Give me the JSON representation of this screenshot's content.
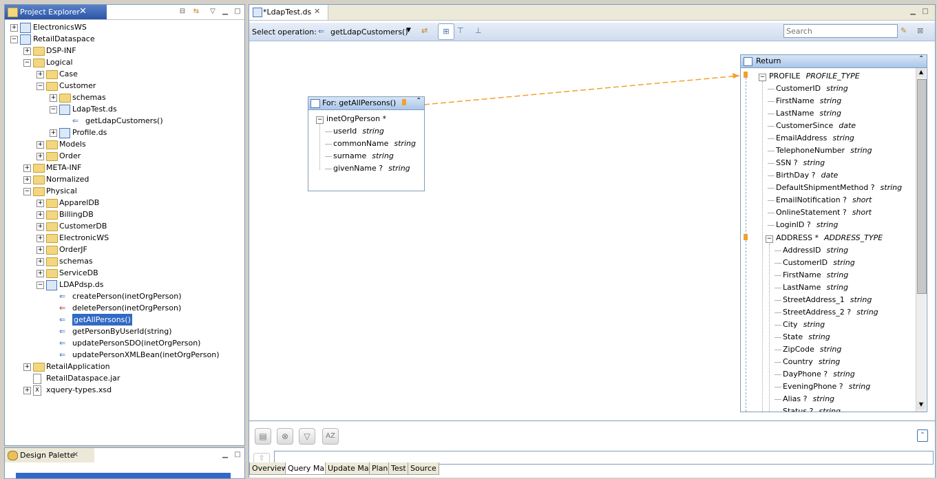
{
  "project_explorer": {
    "title": "Project Explorer",
    "tree": [
      {
        "label": "ElectronicsWS",
        "level": 0,
        "icon": "project-icon",
        "expander": "+"
      },
      {
        "label": "RetailDataspace",
        "level": 0,
        "icon": "project-icon",
        "expander": "-"
      },
      {
        "label": "DSP-INF",
        "level": 1,
        "icon": "folder-icon",
        "expander": "+"
      },
      {
        "label": "Logical",
        "level": 1,
        "icon": "folder-icon",
        "expander": "-"
      },
      {
        "label": "Case",
        "level": 2,
        "icon": "folder-icon",
        "expander": "+"
      },
      {
        "label": "Customer",
        "level": 2,
        "icon": "folder-icon",
        "expander": "-"
      },
      {
        "label": "schemas",
        "level": 3,
        "icon": "folder-icon",
        "expander": "+"
      },
      {
        "label": "LdapTest.ds",
        "level": 3,
        "icon": "dataservice-icon",
        "expander": "-"
      },
      {
        "label": "getLdapCustomers()",
        "level": 4,
        "icon": "operation-icon",
        "expander": ""
      },
      {
        "label": "Profile.ds",
        "level": 3,
        "icon": "dataservice-icon",
        "expander": "+"
      },
      {
        "label": "Models",
        "level": 2,
        "icon": "folder-icon",
        "expander": "+"
      },
      {
        "label": "Order",
        "level": 2,
        "icon": "folder-icon",
        "expander": "+"
      },
      {
        "label": "META-INF",
        "level": 1,
        "icon": "folder-icon",
        "expander": "+"
      },
      {
        "label": "Normalized",
        "level": 1,
        "icon": "folder-icon",
        "expander": "+"
      },
      {
        "label": "Physical",
        "level": 1,
        "icon": "folder-icon",
        "expander": "-"
      },
      {
        "label": "ApparelDB",
        "level": 2,
        "icon": "folder-icon",
        "expander": "+"
      },
      {
        "label": "BillingDB",
        "level": 2,
        "icon": "folder-icon",
        "expander": "+"
      },
      {
        "label": "CustomerDB",
        "level": 2,
        "icon": "folder-icon",
        "expander": "+"
      },
      {
        "label": "ElectronicWS",
        "level": 2,
        "icon": "folder-icon",
        "expander": "+"
      },
      {
        "label": "OrderJF",
        "level": 2,
        "icon": "folder-icon",
        "expander": "+"
      },
      {
        "label": "schemas",
        "level": 2,
        "icon": "folder-icon",
        "expander": "+"
      },
      {
        "label": "ServiceDB",
        "level": 2,
        "icon": "folder-icon",
        "expander": "+"
      },
      {
        "label": "LDAPdsp.ds",
        "level": 2,
        "icon": "dataservice-icon",
        "expander": "-"
      },
      {
        "label": "createPerson(inetOrgPerson)",
        "level": 3,
        "icon": "create-operation-icon",
        "expander": ""
      },
      {
        "label": "deletePerson(inetOrgPerson)",
        "level": 3,
        "icon": "delete-operation-icon",
        "expander": ""
      },
      {
        "label": "getAllPersons()",
        "level": 3,
        "icon": "read-operation-icon",
        "expander": "",
        "selected": true
      },
      {
        "label": "getPersonByUserId(string)",
        "level": 3,
        "icon": "read-operation-icon",
        "expander": ""
      },
      {
        "label": "updatePersonSDO(inetOrgPerson)",
        "level": 3,
        "icon": "update-operation-icon",
        "expander": ""
      },
      {
        "label": "updatePersonXMLBean(inetOrgPerson)",
        "level": 3,
        "icon": "update-operation-icon",
        "expander": ""
      },
      {
        "label": "RetailApplication",
        "level": 1,
        "icon": "folder-icon",
        "expander": "+"
      },
      {
        "label": "RetailDataspace.jar",
        "level": 1,
        "icon": "file-icon",
        "expander": ""
      },
      {
        "label": "xquery-types.xsd",
        "level": 1,
        "icon": "xsd-file-icon",
        "expander": "+"
      }
    ]
  },
  "design_palette": {
    "title": "Design Palette"
  },
  "editor": {
    "tab_title": "*LdapTest.ds",
    "toolbar": {
      "select_operation_label": "Select operation:",
      "operation_value": "getLdapCustomers()",
      "search_placeholder": "Search"
    },
    "for_box": {
      "title": "For: getAllPersons()",
      "root": "inetOrgPerson *",
      "fields": [
        {
          "name": "userId",
          "type": "string"
        },
        {
          "name": "commonName",
          "type": "string"
        },
        {
          "name": "surname",
          "type": "string"
        },
        {
          "name": "givenName ?",
          "type": "string"
        }
      ]
    },
    "return_box": {
      "title": "Return",
      "root": {
        "name": "PROFILE",
        "type": "PROFILE_TYPE"
      },
      "fields": [
        {
          "name": "CustomerID",
          "type": "string"
        },
        {
          "name": "FirstName",
          "type": "string"
        },
        {
          "name": "LastName",
          "type": "string"
        },
        {
          "name": "CustomerSince",
          "type": "date"
        },
        {
          "name": "EmailAddress",
          "type": "string"
        },
        {
          "name": "TelephoneNumber",
          "type": "string"
        },
        {
          "name": "SSN ?",
          "type": "string"
        },
        {
          "name": "BirthDay ?",
          "type": "date"
        },
        {
          "name": "DefaultShipmentMethod ?",
          "type": "string"
        },
        {
          "name": "EmailNotification ?",
          "type": "short"
        },
        {
          "name": "OnlineStatement ?",
          "type": "short"
        },
        {
          "name": "LoginID ?",
          "type": "string"
        }
      ],
      "address": {
        "name": "ADDRESS *",
        "type": "ADDRESS_TYPE"
      },
      "address_fields": [
        {
          "name": "AddressID",
          "type": "string"
        },
        {
          "name": "CustomerID",
          "type": "string"
        },
        {
          "name": "FirstName",
          "type": "string"
        },
        {
          "name": "LastName",
          "type": "string"
        },
        {
          "name": "StreetAddress_1",
          "type": "string"
        },
        {
          "name": "StreetAddress_2 ?",
          "type": "string"
        },
        {
          "name": "City",
          "type": "string"
        },
        {
          "name": "State",
          "type": "string"
        },
        {
          "name": "ZipCode",
          "type": "string"
        },
        {
          "name": "Country",
          "type": "string"
        },
        {
          "name": "DayPhone ?",
          "type": "string"
        },
        {
          "name": "EveningPhone ?",
          "type": "string"
        },
        {
          "name": "Alias ?",
          "type": "string"
        },
        {
          "name": "Status ?",
          "type": "string"
        }
      ]
    },
    "bottom_tabs": [
      "Overview",
      "Query Map",
      "Update Map",
      "Plan",
      "Test",
      "Source"
    ],
    "active_bottom_tab": "Query Map"
  }
}
